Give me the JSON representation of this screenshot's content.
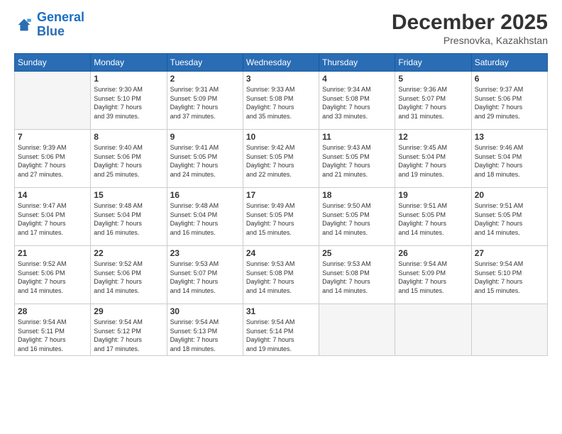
{
  "header": {
    "logo_line1": "General",
    "logo_line2": "Blue",
    "month_year": "December 2025",
    "location": "Presnovka, Kazakhstan"
  },
  "weekdays": [
    "Sunday",
    "Monday",
    "Tuesday",
    "Wednesday",
    "Thursday",
    "Friday",
    "Saturday"
  ],
  "weeks": [
    [
      {
        "day": "",
        "info": ""
      },
      {
        "day": "1",
        "info": "Sunrise: 9:30 AM\nSunset: 5:10 PM\nDaylight: 7 hours\nand 39 minutes."
      },
      {
        "day": "2",
        "info": "Sunrise: 9:31 AM\nSunset: 5:09 PM\nDaylight: 7 hours\nand 37 minutes."
      },
      {
        "day": "3",
        "info": "Sunrise: 9:33 AM\nSunset: 5:08 PM\nDaylight: 7 hours\nand 35 minutes."
      },
      {
        "day": "4",
        "info": "Sunrise: 9:34 AM\nSunset: 5:08 PM\nDaylight: 7 hours\nand 33 minutes."
      },
      {
        "day": "5",
        "info": "Sunrise: 9:36 AM\nSunset: 5:07 PM\nDaylight: 7 hours\nand 31 minutes."
      },
      {
        "day": "6",
        "info": "Sunrise: 9:37 AM\nSunset: 5:06 PM\nDaylight: 7 hours\nand 29 minutes."
      }
    ],
    [
      {
        "day": "7",
        "info": "Sunrise: 9:39 AM\nSunset: 5:06 PM\nDaylight: 7 hours\nand 27 minutes."
      },
      {
        "day": "8",
        "info": "Sunrise: 9:40 AM\nSunset: 5:06 PM\nDaylight: 7 hours\nand 25 minutes."
      },
      {
        "day": "9",
        "info": "Sunrise: 9:41 AM\nSunset: 5:05 PM\nDaylight: 7 hours\nand 24 minutes."
      },
      {
        "day": "10",
        "info": "Sunrise: 9:42 AM\nSunset: 5:05 PM\nDaylight: 7 hours\nand 22 minutes."
      },
      {
        "day": "11",
        "info": "Sunrise: 9:43 AM\nSunset: 5:05 PM\nDaylight: 7 hours\nand 21 minutes."
      },
      {
        "day": "12",
        "info": "Sunrise: 9:45 AM\nSunset: 5:04 PM\nDaylight: 7 hours\nand 19 minutes."
      },
      {
        "day": "13",
        "info": "Sunrise: 9:46 AM\nSunset: 5:04 PM\nDaylight: 7 hours\nand 18 minutes."
      }
    ],
    [
      {
        "day": "14",
        "info": "Sunrise: 9:47 AM\nSunset: 5:04 PM\nDaylight: 7 hours\nand 17 minutes."
      },
      {
        "day": "15",
        "info": "Sunrise: 9:48 AM\nSunset: 5:04 PM\nDaylight: 7 hours\nand 16 minutes."
      },
      {
        "day": "16",
        "info": "Sunrise: 9:48 AM\nSunset: 5:04 PM\nDaylight: 7 hours\nand 16 minutes."
      },
      {
        "day": "17",
        "info": "Sunrise: 9:49 AM\nSunset: 5:05 PM\nDaylight: 7 hours\nand 15 minutes."
      },
      {
        "day": "18",
        "info": "Sunrise: 9:50 AM\nSunset: 5:05 PM\nDaylight: 7 hours\nand 14 minutes."
      },
      {
        "day": "19",
        "info": "Sunrise: 9:51 AM\nSunset: 5:05 PM\nDaylight: 7 hours\nand 14 minutes."
      },
      {
        "day": "20",
        "info": "Sunrise: 9:51 AM\nSunset: 5:05 PM\nDaylight: 7 hours\nand 14 minutes."
      }
    ],
    [
      {
        "day": "21",
        "info": "Sunrise: 9:52 AM\nSunset: 5:06 PM\nDaylight: 7 hours\nand 14 minutes."
      },
      {
        "day": "22",
        "info": "Sunrise: 9:52 AM\nSunset: 5:06 PM\nDaylight: 7 hours\nand 14 minutes."
      },
      {
        "day": "23",
        "info": "Sunrise: 9:53 AM\nSunset: 5:07 PM\nDaylight: 7 hours\nand 14 minutes."
      },
      {
        "day": "24",
        "info": "Sunrise: 9:53 AM\nSunset: 5:08 PM\nDaylight: 7 hours\nand 14 minutes."
      },
      {
        "day": "25",
        "info": "Sunrise: 9:53 AM\nSunset: 5:08 PM\nDaylight: 7 hours\nand 14 minutes."
      },
      {
        "day": "26",
        "info": "Sunrise: 9:54 AM\nSunset: 5:09 PM\nDaylight: 7 hours\nand 15 minutes."
      },
      {
        "day": "27",
        "info": "Sunrise: 9:54 AM\nSunset: 5:10 PM\nDaylight: 7 hours\nand 15 minutes."
      }
    ],
    [
      {
        "day": "28",
        "info": "Sunrise: 9:54 AM\nSunset: 5:11 PM\nDaylight: 7 hours\nand 16 minutes."
      },
      {
        "day": "29",
        "info": "Sunrise: 9:54 AM\nSunset: 5:12 PM\nDaylight: 7 hours\nand 17 minutes."
      },
      {
        "day": "30",
        "info": "Sunrise: 9:54 AM\nSunset: 5:13 PM\nDaylight: 7 hours\nand 18 minutes."
      },
      {
        "day": "31",
        "info": "Sunrise: 9:54 AM\nSunset: 5:14 PM\nDaylight: 7 hours\nand 19 minutes."
      },
      {
        "day": "",
        "info": ""
      },
      {
        "day": "",
        "info": ""
      },
      {
        "day": "",
        "info": ""
      }
    ]
  ]
}
